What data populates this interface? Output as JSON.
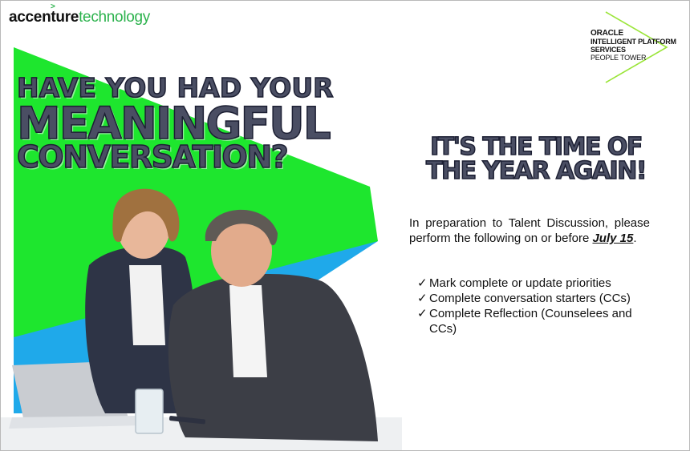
{
  "logo": {
    "accenture": "accenture",
    "technology": "technology",
    "caret": ">"
  },
  "badge": {
    "line1": "ORACLE",
    "line2": "INTELLIGENT PLATFORM",
    "line3": "SERVICES",
    "line4": "PEOPLE TOWER"
  },
  "headline": {
    "line1": "HAVE YOU HAD YOUR",
    "line2": "MEANINGFUL",
    "line3": "CONVERSATION?"
  },
  "subheadline": {
    "line1": "IT'S THE TIME OF",
    "line2": "THE YEAR AGAIN!"
  },
  "intro": {
    "text": "In preparation to Talent Discussion, please perform the following on or before ",
    "date": "July 15",
    "end": "."
  },
  "checklist": [
    {
      "mark": "✓",
      "text": "Mark complete or update priorities"
    },
    {
      "mark": "✓",
      "text": "Complete conversation starters (CCs)"
    },
    {
      "mark": "✓",
      "text": "Complete Reflection (Counselees and CCs)"
    }
  ],
  "colors": {
    "green": "#1ee62e",
    "blue": "#1fa9ea",
    "accent": "#2bb24c",
    "headline_fill": "#4a4e63"
  }
}
